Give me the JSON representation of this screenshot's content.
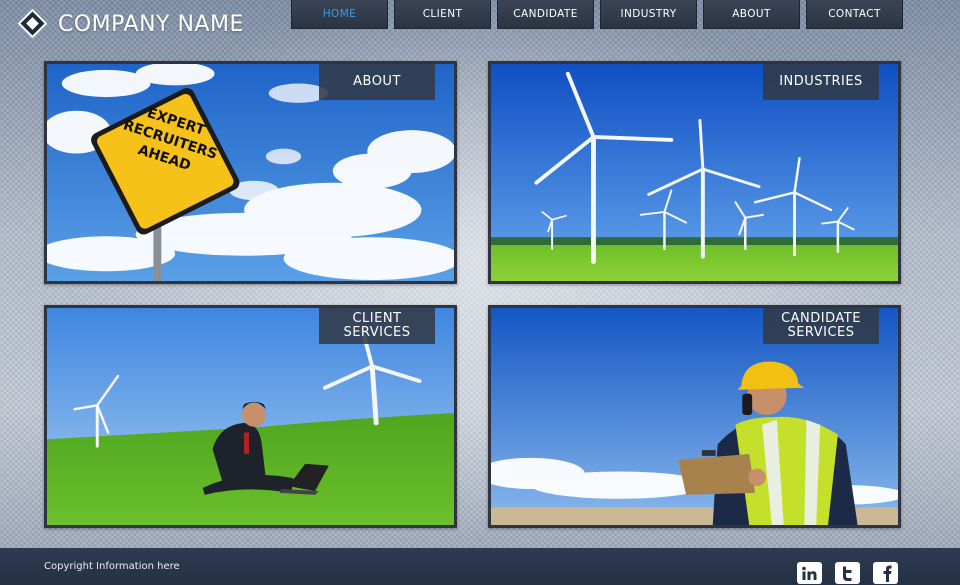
{
  "header": {
    "company_name": "COMPANY NAME",
    "nav": [
      {
        "label": "HOME",
        "active": true
      },
      {
        "label": "CLIENT",
        "active": false
      },
      {
        "label": "CANDIDATE",
        "active": false
      },
      {
        "label": "INDUSTRY",
        "active": false
      },
      {
        "label": "ABOUT",
        "active": false
      },
      {
        "label": "CONTACT",
        "active": false
      }
    ]
  },
  "panels": [
    {
      "label": "ABOUT",
      "image": "expert-recruiters-ahead-sign",
      "sign_text": [
        "EXPERT",
        "RECRUITERS",
        "AHEAD"
      ]
    },
    {
      "label": "INDUSTRIES",
      "image": "wind-turbines-field"
    },
    {
      "label_lines": [
        "CLIENT",
        "SERVICES"
      ],
      "image": "businessman-laptop-in-field"
    },
    {
      "label_lines": [
        "CANDIDATE",
        "SERVICES"
      ],
      "image": "engineer-hardhat-on-phone"
    }
  ],
  "footer": {
    "copyright": "Copyright Information here",
    "social": [
      "linkedin-icon",
      "twitter-icon",
      "facebook-icon"
    ]
  },
  "colors": {
    "nav_bg": "#2b3443",
    "nav_active_text": "#3d9be9",
    "panel_border": "#2e3440",
    "footer_bg": "#243044"
  }
}
